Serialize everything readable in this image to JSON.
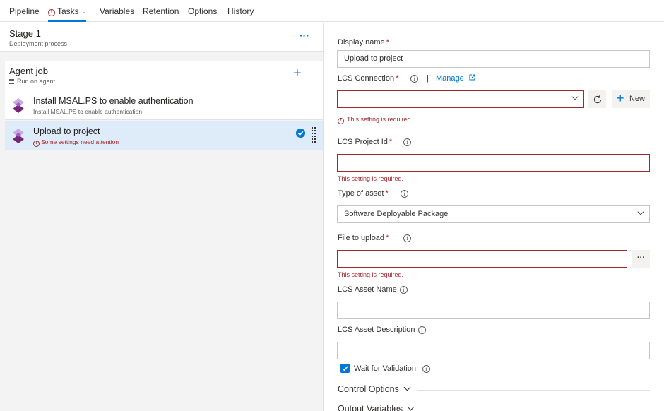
{
  "tabs": [
    {
      "label": "Pipeline"
    },
    {
      "label": "Tasks",
      "warning": "!"
    },
    {
      "label": "Variables"
    },
    {
      "label": "Retention"
    },
    {
      "label": "Options"
    },
    {
      "label": "History"
    }
  ],
  "stage": {
    "title": "Stage 1",
    "subtitle": "Deployment process",
    "more": "···"
  },
  "job": {
    "title": "Agent job",
    "subtitle": "Run on agent",
    "add": "+"
  },
  "tasks": [
    {
      "title": "Install MSAL.PS to enable authentication",
      "subtitle": "Install MSAL.PS to enable authentication"
    },
    {
      "title": "Upload to project",
      "subtitle": "Some settings need attention",
      "warning": "!"
    }
  ],
  "form": {
    "display_name": {
      "label": "Display name",
      "required": "*",
      "value": "Upload  to project"
    },
    "lcs_connection": {
      "label": "LCS Connection",
      "required": "*",
      "separator": "|",
      "manage": "Manage",
      "value": "",
      "error": "This setting is required.",
      "new_label": "New"
    },
    "lcs_project_id": {
      "label": "LCS Project Id",
      "required": "*",
      "value": "",
      "error": "This setting is required."
    },
    "type_of_asset": {
      "label": "Type of asset",
      "required": "*",
      "value": "Software Deployable Package"
    },
    "file_to_upload": {
      "label": "File to upload",
      "required": "*",
      "value": "",
      "error": "This setting is required.",
      "browse": "···"
    },
    "lcs_asset_name": {
      "label": "LCS Asset Name",
      "value": ""
    },
    "lcs_asset_description": {
      "label": "LCS Asset Description",
      "value": ""
    },
    "wait_for_validation": {
      "label": "Wait for Validation",
      "checked": true
    },
    "info_glyph": "i"
  },
  "sections": {
    "control_options": "Control Options",
    "output_variables": "Output Variables"
  },
  "colors": {
    "accent": "#0078d4",
    "error": "#a4262c",
    "selected_bg": "#deecf9"
  }
}
